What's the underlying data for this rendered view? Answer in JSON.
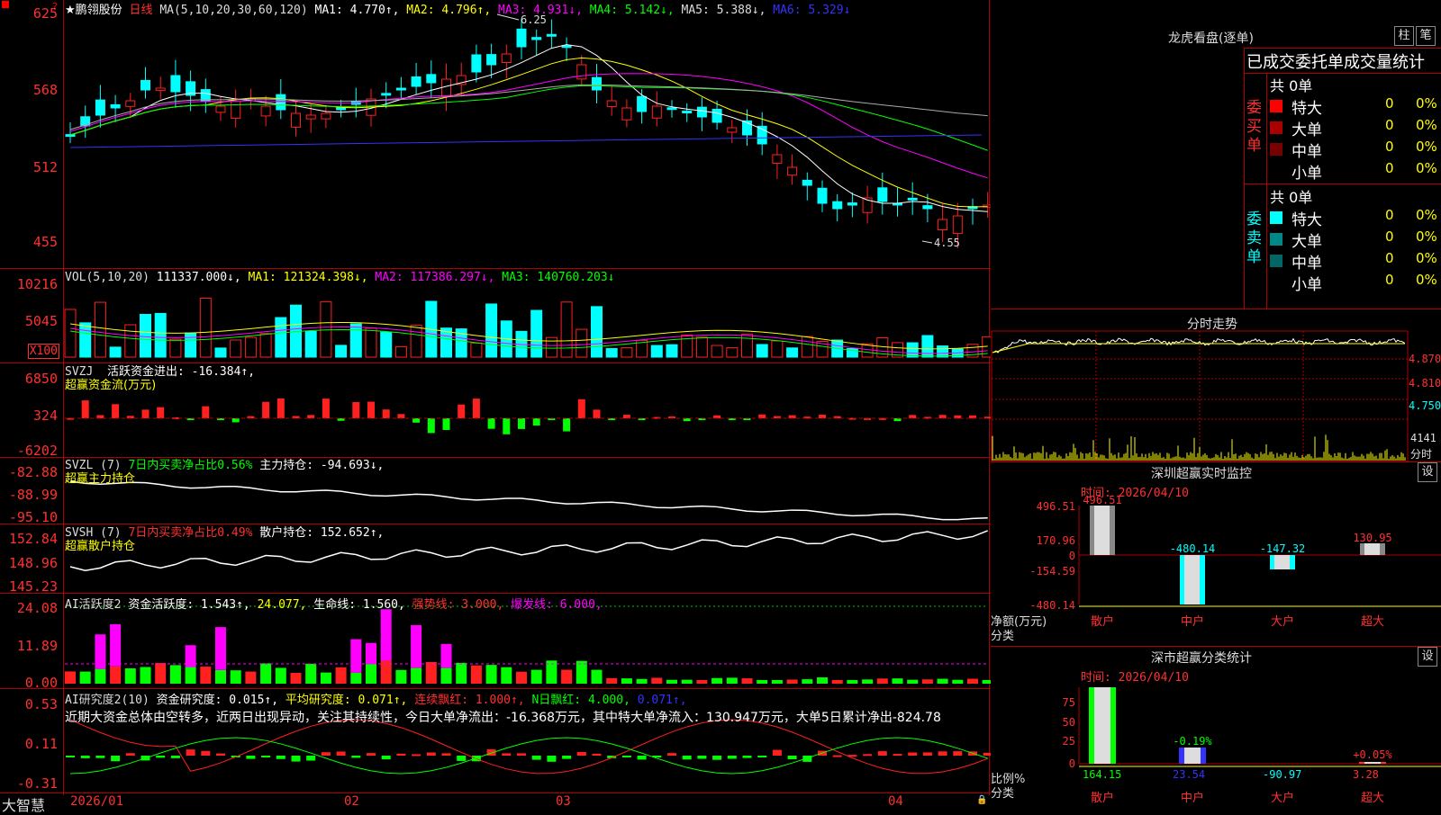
{
  "app": {
    "brand": "大智慧"
  },
  "stock": {
    "name": "★鹏翎股份",
    "period": "日线"
  },
  "main_chart": {
    "ma_header": "MA(5,10,20,30,60,120)",
    "ma_values": [
      {
        "label": "MA1: 4.770↑,",
        "color": "#ffffff"
      },
      {
        "label": "MA2: 4.796↑,",
        "color": "#ffff00"
      },
      {
        "label": "MA3: 4.931↓,",
        "color": "#ff00ff"
      },
      {
        "label": "MA4: 5.142↓,",
        "color": "#00ff00"
      },
      {
        "label": "MA5: 5.388↓,",
        "color": "#dddddd"
      },
      {
        "label": "MA6: 5.329↓",
        "color": "#3333ff"
      }
    ],
    "y_labels": [
      "625",
      "568",
      "512",
      "455"
    ],
    "high_mark": "6.25",
    "low_mark": "4.55"
  },
  "volume": {
    "header": "VOL(5,10,20)",
    "value": "111337.000↓,",
    "ma1": "MA1: 121324.398↓,",
    "ma2": "MA2: 117386.297↓,",
    "ma3": "MA3: 140760.203↓",
    "y_labels": [
      "10216",
      "5045"
    ],
    "unit": "X100"
  },
  "svzj": {
    "header": "SVZJ",
    "line1": "活跃资金进出: -16.384↑,",
    "line2": "超赢资金流(万元)",
    "y_labels": [
      "6850",
      "324",
      "-6202"
    ]
  },
  "svzl": {
    "header": "SVZL (7)",
    "ratio": "7日内买卖净占比0.56%",
    "main": "主力持仓: -94.693↓,",
    "line2": "超赢主力持仓",
    "y_labels": [
      "-82.88",
      "-88.99",
      "-95.10"
    ]
  },
  "svsh": {
    "header": "SVSH (7)",
    "ratio": "7日内买卖净占比0.49%",
    "main": "散户持仓: 152.652↑,",
    "line2": "超赢散户持仓",
    "y_labels": [
      "152.84",
      "148.96",
      "145.23"
    ]
  },
  "ai_active": {
    "header": "AI活跃度2",
    "v1": "资金活跃度: 1.543↑,",
    "v2": "24.077,",
    "v3": "生命线: 1.560,",
    "v4": "强势线: 3.000,",
    "v5": "爆发线: 6.000,",
    "y_labels": [
      "24.08",
      "11.89",
      "0.00"
    ]
  },
  "ai_research": {
    "header": "AI研究度2(10)",
    "v1": "资金研究度: 0.015↑,",
    "v2": "平均研究度: 0.071↑,",
    "v3": "连续飘红: 1.000↑,",
    "v4": "N日飘红: 4.000,",
    "v5": "0.071↑,",
    "comment": "近期大资金总体由空转多，近两日出现异动，关注其持续性，今日大单净流出：-16.368万元，其中特大单净流入：130.947万元，大单5日累计净出-824.78",
    "y_labels": [
      "0.53",
      "0.11",
      "-0.31"
    ]
  },
  "x_axis": [
    "2026/01",
    "02",
    "03",
    "04"
  ],
  "dragon_tiger": {
    "title": "龙虎看盘(逐单)",
    "btn1": "柱",
    "btn2": "笔",
    "subtitle": "已成交委托单成交量统计",
    "buy_side": "委买单",
    "sell_side": "委卖单",
    "buy_total": "共 0单",
    "sell_total": "共 0单",
    "buy_rows": [
      {
        "label": "特大",
        "value": "0",
        "pct": "0%",
        "color": "#ff0000"
      },
      {
        "label": "大单",
        "value": "0",
        "pct": "0%",
        "color": "#aa0000"
      },
      {
        "label": "中单",
        "value": "0",
        "pct": "0%",
        "color": "#770000"
      },
      {
        "label": "小单",
        "value": "0",
        "pct": "0%",
        "color": "#000000"
      }
    ],
    "sell_rows": [
      {
        "label": "特大",
        "value": "0",
        "pct": "0%",
        "color": "#00ffff"
      },
      {
        "label": "大单",
        "value": "0",
        "pct": "0%",
        "color": "#008888"
      },
      {
        "label": "中单",
        "value": "0",
        "pct": "0%",
        "color": "#006666"
      },
      {
        "label": "小单",
        "value": "0",
        "pct": "0%",
        "color": "#000000"
      }
    ]
  },
  "intraday": {
    "title": "分时走势",
    "y_labels": [
      "4.870",
      "4.810",
      "4.750"
    ],
    "vol_label": "4141",
    "fen_label": "分时"
  },
  "monitor": {
    "title": "深圳超赢实时监控",
    "settings": "设",
    "time": "时间: 2026/04/10",
    "y_labels": [
      "496.51",
      "170.96",
      "0",
      "-154.59",
      "-480.14"
    ],
    "axis_label": "净额(万元)",
    "cat_label": "分类",
    "categories": [
      "散户",
      "中户",
      "大户",
      "超大"
    ],
    "values": [
      "496.51",
      "-480.14",
      "-147.32",
      "130.95"
    ]
  },
  "classify": {
    "title": "深市超赢分类统计",
    "settings": "设",
    "time": "时间: 2026/04/10",
    "y_labels": [
      "75",
      "50",
      "25",
      "0"
    ],
    "axis_label": "比例%",
    "cat_label": "分类",
    "categories": [
      "散户",
      "中户",
      "大户",
      "超大"
    ],
    "values": [
      "164.15",
      "23.54",
      "-90.97",
      "3.28"
    ],
    "pcts": [
      "-0.19%",
      "+0.05%"
    ]
  }
}
